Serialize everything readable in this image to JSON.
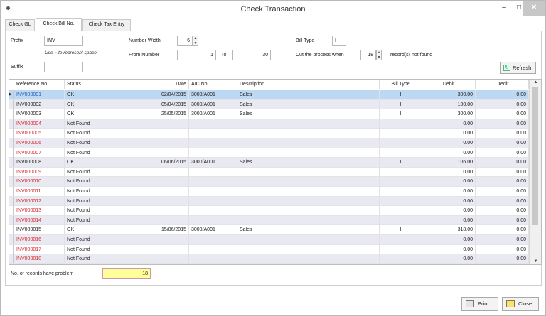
{
  "window": {
    "title": "Check Transaction",
    "min_glyph": "–",
    "max_glyph": "□",
    "close_glyph": "✕"
  },
  "tabs": [
    {
      "label": "Check GL"
    },
    {
      "label": "Check Bill No."
    },
    {
      "label": "Check Tax Entry"
    }
  ],
  "form": {
    "prefix_label": "Prefix",
    "prefix_value": "INV",
    "hint": "Use ~ to represent space",
    "suffix_label": "Suffix",
    "suffix_value": "",
    "number_width_label": "Number Width",
    "number_width_value": "6",
    "from_number_label": "From Number",
    "from_value": "1",
    "to_label": "To",
    "to_value": "30",
    "bill_type_label": "Bill Type",
    "bill_type_value": "I",
    "cut_label": "Cut the process when",
    "cut_value": "18",
    "cut_suffix": "record(s) not found",
    "refresh_label": "Refresh"
  },
  "grid": {
    "columns": [
      "Reference No.",
      "Status",
      "Date",
      "A/C No.",
      "Description",
      "Bill Type",
      "Debit",
      "Credit"
    ],
    "rows": [
      {
        "ref": "INV000001",
        "status": "OK",
        "date": "02/04/2015",
        "ac": "3000/A001",
        "desc": "Sales",
        "type": "I",
        "debit": "300.00",
        "credit": "0.00",
        "bad": false
      },
      {
        "ref": "INV000002",
        "status": "OK",
        "date": "05/04/2015",
        "ac": "3000/A001",
        "desc": "Sales",
        "type": "I",
        "debit": "100.00",
        "credit": "0.00",
        "bad": false
      },
      {
        "ref": "INV000003",
        "status": "OK",
        "date": "25/05/2015",
        "ac": "3000/A001",
        "desc": "Sales",
        "type": "I",
        "debit": "300.00",
        "credit": "0.00",
        "bad": false
      },
      {
        "ref": "INV000004",
        "status": "Not Found",
        "date": "",
        "ac": "",
        "desc": "",
        "type": "",
        "debit": "0.00",
        "credit": "0.00",
        "bad": true
      },
      {
        "ref": "INV000005",
        "status": "Not Found",
        "date": "",
        "ac": "",
        "desc": "",
        "type": "",
        "debit": "0.00",
        "credit": "0.00",
        "bad": true
      },
      {
        "ref": "INV000006",
        "status": "Not Found",
        "date": "",
        "ac": "",
        "desc": "",
        "type": "",
        "debit": "0.00",
        "credit": "0.00",
        "bad": true
      },
      {
        "ref": "INV000007",
        "status": "Not Found",
        "date": "",
        "ac": "",
        "desc": "",
        "type": "",
        "debit": "0.00",
        "credit": "0.00",
        "bad": true
      },
      {
        "ref": "INV000008",
        "status": "OK",
        "date": "06/06/2015",
        "ac": "3000/A001",
        "desc": "Sales",
        "type": "I",
        "debit": "106.00",
        "credit": "0.00",
        "bad": false
      },
      {
        "ref": "INV000009",
        "status": "Not Found",
        "date": "",
        "ac": "",
        "desc": "",
        "type": "",
        "debit": "0.00",
        "credit": "0.00",
        "bad": true
      },
      {
        "ref": "INV000010",
        "status": "Not Found",
        "date": "",
        "ac": "",
        "desc": "",
        "type": "",
        "debit": "0.00",
        "credit": "0.00",
        "bad": true
      },
      {
        "ref": "INV000011",
        "status": "Not Found",
        "date": "",
        "ac": "",
        "desc": "",
        "type": "",
        "debit": "0.00",
        "credit": "0.00",
        "bad": true
      },
      {
        "ref": "INV000012",
        "status": "Not Found",
        "date": "",
        "ac": "",
        "desc": "",
        "type": "",
        "debit": "0.00",
        "credit": "0.00",
        "bad": true
      },
      {
        "ref": "INV000013",
        "status": "Not Found",
        "date": "",
        "ac": "",
        "desc": "",
        "type": "",
        "debit": "0.00",
        "credit": "0.00",
        "bad": true
      },
      {
        "ref": "INV000014",
        "status": "Not Found",
        "date": "",
        "ac": "",
        "desc": "",
        "type": "",
        "debit": "0.00",
        "credit": "0.00",
        "bad": true
      },
      {
        "ref": "INV000015",
        "status": "OK",
        "date": "15/06/2015",
        "ac": "3000/A001",
        "desc": "Sales",
        "type": "I",
        "debit": "318.00",
        "credit": "0.00",
        "bad": false
      },
      {
        "ref": "INV000016",
        "status": "Not Found",
        "date": "",
        "ac": "",
        "desc": "",
        "type": "",
        "debit": "0.00",
        "credit": "0.00",
        "bad": true
      },
      {
        "ref": "INV000017",
        "status": "Not Found",
        "date": "",
        "ac": "",
        "desc": "",
        "type": "",
        "debit": "0.00",
        "credit": "0.00",
        "bad": true
      },
      {
        "ref": "INV000018",
        "status": "Not Found",
        "date": "",
        "ac": "",
        "desc": "",
        "type": "",
        "debit": "0.00",
        "credit": "0.00",
        "bad": true
      }
    ]
  },
  "summary": {
    "problem_label": "No. of records have problem",
    "problem_value": "18"
  },
  "footer": {
    "print_label": "Print",
    "close_label": "Close"
  },
  "colors": {
    "selected_row": "#bcd8f2",
    "not_found_text": "#d8262c",
    "problem_field": "#ffff99"
  }
}
